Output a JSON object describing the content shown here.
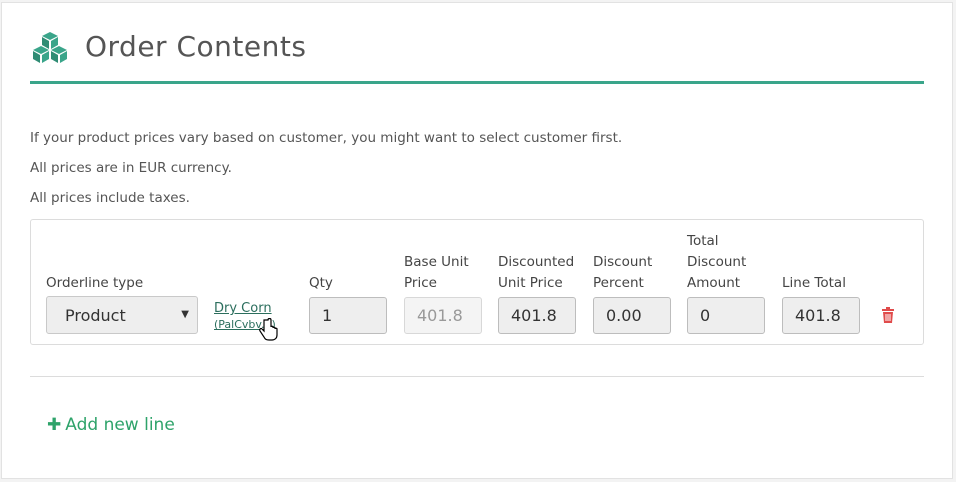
{
  "header": {
    "title": "Order Contents",
    "icon": "boxes-icon",
    "accent": "#3aa58a"
  },
  "info": [
    "If your product prices vary based on customer, you might want to select customer first.",
    "All prices are in EUR currency.",
    "All prices include taxes."
  ],
  "columns": {
    "orderline_type": "Orderline type",
    "qty": "Qty",
    "base_unit_price_1": "Base Unit",
    "base_unit_price_2": "Price",
    "discounted_unit_price_1": "Discounted",
    "discounted_unit_price_2": "Unit Price",
    "discount_percent_1": "Discount",
    "discount_percent_2": "Percent",
    "total_discount_amount_1": "Total",
    "total_discount_amount_2": "Discount",
    "total_discount_amount_3": "Amount",
    "line_total": "Line Total"
  },
  "line": {
    "type": "Product",
    "product_name": "Dry Corn",
    "product_sku": "(PalCvbv...)",
    "qty": "1",
    "base_unit_price": "401.8",
    "discounted_unit_price": "401.8",
    "discount_percent": "0.00",
    "total_discount_amount": "0",
    "line_total": "401.8"
  },
  "actions": {
    "add_line": "Add new line",
    "add_color": "#2ea36a",
    "delete_color": "#e04b4b"
  }
}
